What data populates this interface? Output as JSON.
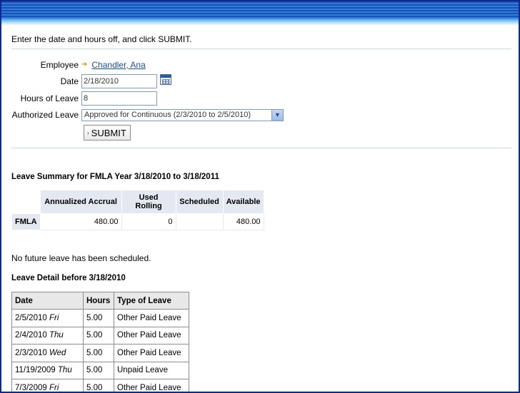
{
  "instructions": "Enter the date and hours off, and click SUBMIT.",
  "form": {
    "employee_label": "Employee",
    "employee_name": "Chandler, Ana",
    "date_label": "Date",
    "date_value": "2/18/2010",
    "hours_label": "Hours of Leave",
    "hours_value": "8",
    "authorized_label": "Authorized Leave",
    "authorized_value": "Approved for Continuous (2/3/2010 to 2/5/2010)",
    "submit_label": "SUBMIT"
  },
  "summary": {
    "title": "Leave Summary for FMLA Year 3/18/2010 to 3/18/2011",
    "headers": [
      "Annualized Accrual",
      "Used Rolling",
      "Scheduled",
      "Available"
    ],
    "row_label": "FMLA",
    "values": [
      "480.00",
      "0",
      "",
      "480.00"
    ]
  },
  "no_future": "No future leave has been scheduled.",
  "detail": {
    "title": "Leave Detail before 3/18/2010",
    "headers": [
      "Date",
      "Hours",
      "Type of Leave"
    ],
    "rows": [
      {
        "date": "2/5/2010",
        "day": "Fri",
        "hours": "5.00",
        "type": "Other Paid Leave"
      },
      {
        "date": "2/4/2010",
        "day": "Thu",
        "hours": "5.00",
        "type": "Other Paid Leave"
      },
      {
        "date": "2/3/2010",
        "day": "Wed",
        "hours": "5.00",
        "type": "Other Paid Leave"
      },
      {
        "date": "11/19/2009",
        "day": "Thu",
        "hours": "5.00",
        "type": "Unpaid Leave"
      },
      {
        "date": "7/3/2009",
        "day": "Fri",
        "hours": "5.00",
        "type": "Other Paid Leave"
      }
    ]
  },
  "icons": {
    "calendar": "calendar-icon",
    "arrow": "arrow-right-icon",
    "dropdown": "chevron-down-icon"
  },
  "colors": {
    "frame": "#0a2a8c",
    "link": "#1a4f9a",
    "header_bg": "#e4e9f1"
  }
}
